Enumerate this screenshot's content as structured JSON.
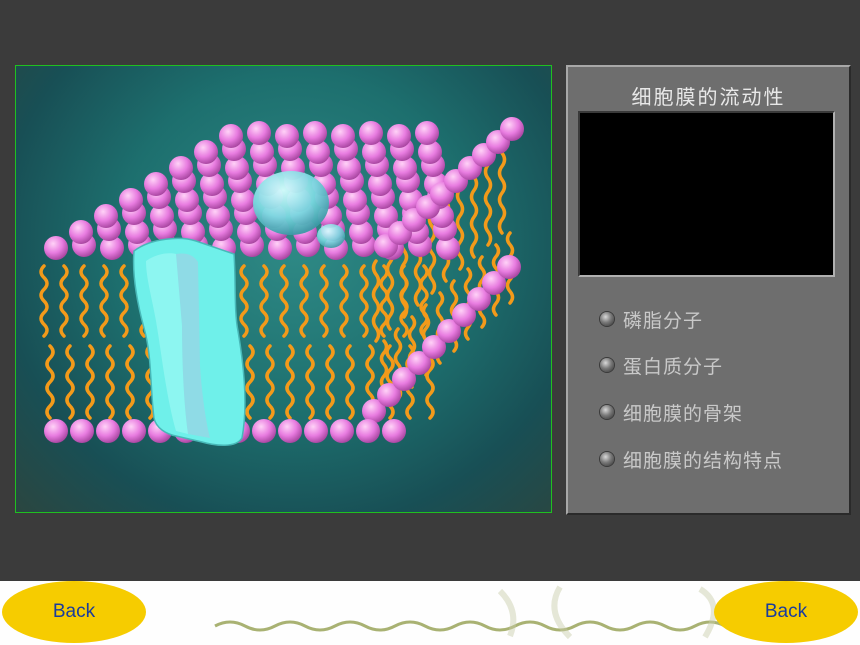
{
  "panel": {
    "title": "细胞膜的流动性",
    "options": [
      {
        "label": "磷脂分子"
      },
      {
        "label": "蛋白质分子"
      },
      {
        "label": "细胞膜的骨架"
      },
      {
        "label": "细胞膜的结构特点"
      }
    ]
  },
  "footer": {
    "back_left_label": "Back",
    "back_right_label": "Back"
  },
  "colors": {
    "background": "#3b3b3b",
    "phospholipid_head": "#e87ce0",
    "phospholipid_tail": "#f39a1a",
    "protein": "#6ff0ea",
    "button": "#f6cc00",
    "button_text": "#1a3c9c"
  }
}
